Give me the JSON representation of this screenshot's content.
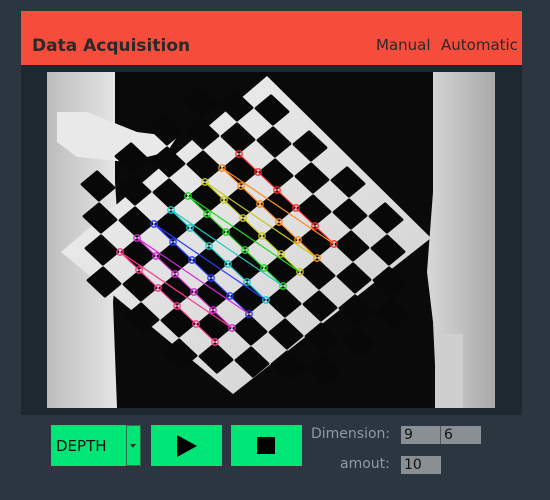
{
  "header": {
    "title": "Data Acquisition",
    "buttons": {
      "manual": "Manual",
      "automatic": "Automatic"
    },
    "accent_color": "#f54c3c"
  },
  "viewer": {
    "icon": "depth-image-checkerboard-with-detected-corners"
  },
  "controls": {
    "mode_select": {
      "value": "DEPTH",
      "icon": "chevron-down-icon"
    },
    "play": {
      "icon": "play-icon"
    },
    "stop": {
      "icon": "stop-icon"
    },
    "button_color": "#00e676"
  },
  "settings": {
    "dimension_label": "Dimension:",
    "dimension_x": "9",
    "dimension_y": "6",
    "amount_label": "amout:",
    "amount": "10"
  }
}
